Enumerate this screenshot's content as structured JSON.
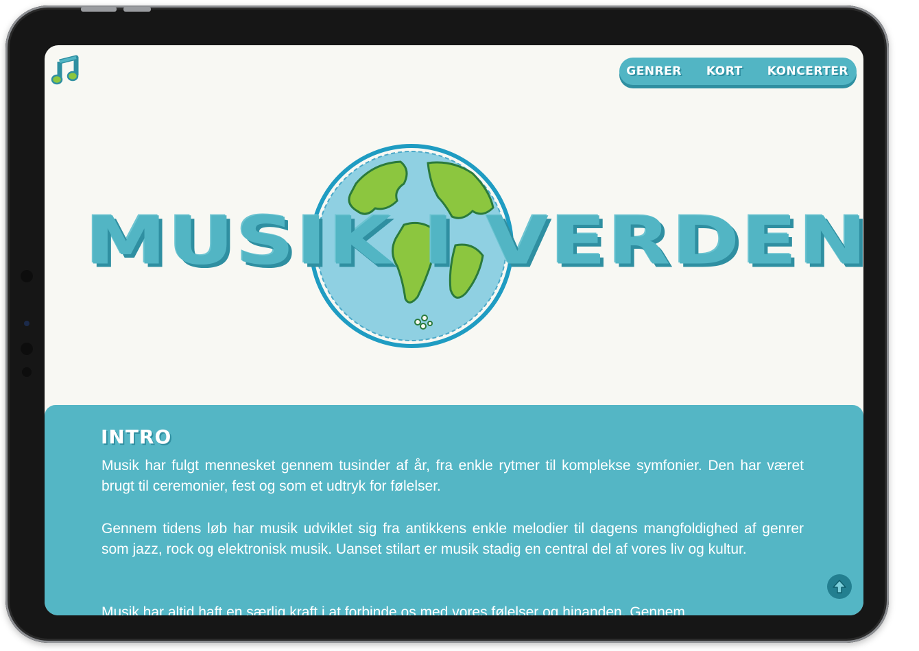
{
  "nav": {
    "items": [
      {
        "label": "GENRER"
      },
      {
        "label": "KORT"
      },
      {
        "label": "KONCERTER"
      }
    ]
  },
  "icons": {
    "logo": "music-note-icon",
    "scroll_top": "arrow-up-icon"
  },
  "hero": {
    "title": "MUSIK I VERDEN"
  },
  "intro": {
    "heading": "INTRO",
    "paragraphs": [
      "Musik har fulgt mennesket gennem tusinder af år, fra enkle rytmer til komplekse symfonier. Den har været brugt til ceremonier, fest og som et udtryk for følelser.",
      "Gennem tidens løb har musik udviklet sig fra antikkens enkle melodier til dagens mangfoldighed af genrer som jazz, rock og elektronisk musik. Uanset stilart er musik stadig en central del af vores liv og kultur.",
      "Musik har altid haft en særlig kraft i at forbinde os med vores følelser og hinanden. Gennem"
    ]
  },
  "colors": {
    "accent": "#52b5c4",
    "accent_dark": "#2f8fa1",
    "background": "#f8f8f3",
    "globe_land": "#8cc63f",
    "globe_water": "#4aa8c8"
  }
}
